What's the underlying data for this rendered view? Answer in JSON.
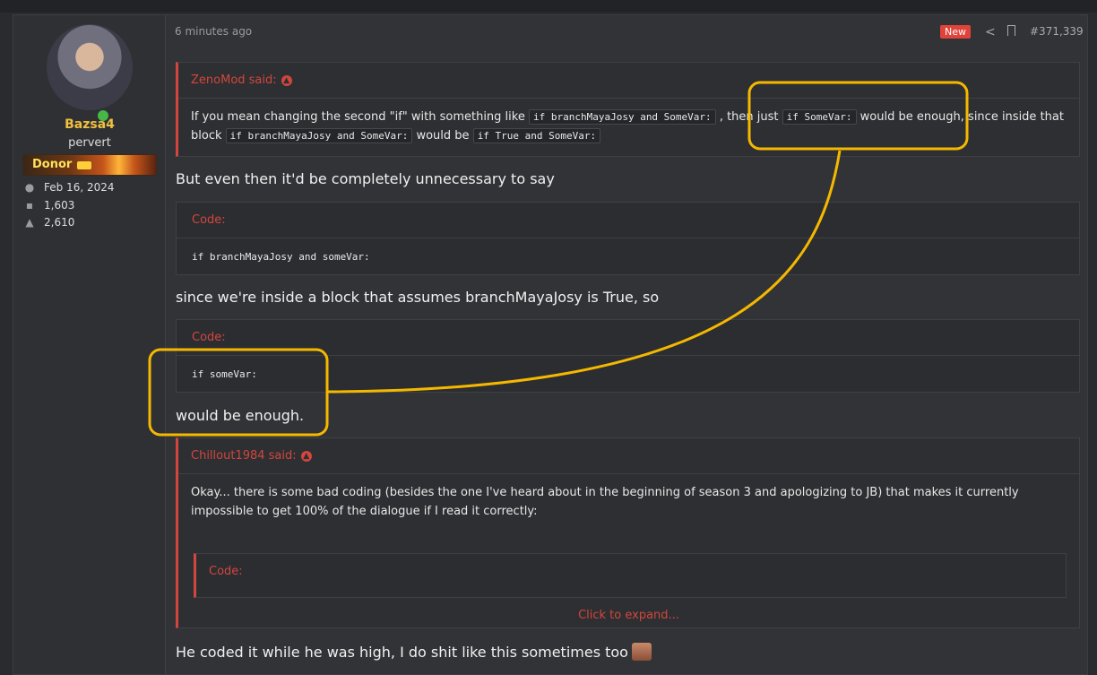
{
  "user": {
    "name": "Bazsa4",
    "title": "pervert",
    "banner": "Donor",
    "joined": "Feb 16, 2024",
    "messages": "1,603",
    "reactions": "2,610"
  },
  "post": {
    "time": "6 minutes ago",
    "new_badge": "New",
    "number": "#371,339"
  },
  "quote1": {
    "author": "ZenoMod said:",
    "text1": "If you mean changing the second \"if\" with something like",
    "code1": "if branchMayaJosy and SomeVar:",
    "text2": ", then just",
    "code2": "if SomeVar:",
    "text3": "would be enough, since inside that block",
    "code3": "if branchMayaJosy and SomeVar:",
    "text4": "would be",
    "code4": "if True and SomeVar:"
  },
  "para1": "But even then it'd be completely unnecessary to say",
  "code_block1": {
    "label": "Code:",
    "code": "if branchMayaJosy and someVar:"
  },
  "para2": "since we're inside a block that assumes branchMayaJosy is True, so",
  "code_block2": {
    "label": "Code:",
    "code": "if someVar:"
  },
  "para3": "would be enough.",
  "quote2": {
    "author": "Chillout1984 said:",
    "text": "Okay... there is some bad coding (besides the one I've heard about in the beginning of season 3 and apologizing to JB) that makes it currently impossible to get 100% of the dialogue if I read it correctly:",
    "nested_label": "Code:",
    "expand": "Click to expand..."
  },
  "para4": "He coded it while he was high, I do shit like this sometimes too",
  "colors": {
    "accent": "#d2463d",
    "highlight": "#f5b800",
    "username": "#f0c040"
  }
}
